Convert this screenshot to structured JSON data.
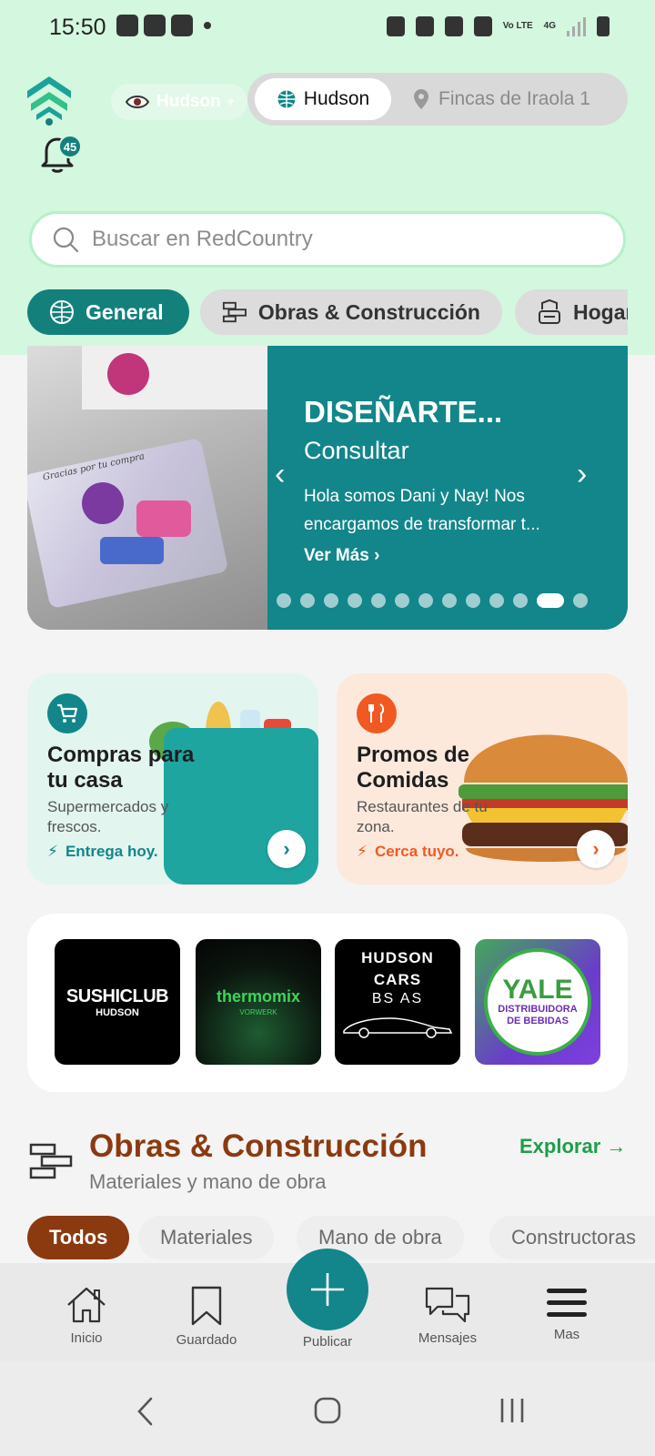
{
  "status_bar": {
    "time": "15:50",
    "network_label": "4G",
    "lte_label": "Vo LTE"
  },
  "header": {
    "notifications_count": "45",
    "community_selector": "Hudson",
    "location_toggle": {
      "active": "Hudson",
      "inactive": "Fincas de Iraola 1"
    }
  },
  "search": {
    "placeholder": "Buscar en RedCountry"
  },
  "categories": [
    {
      "label": "General",
      "active": true
    },
    {
      "label": "Obras & Construcción",
      "active": false
    },
    {
      "label": "Hogar",
      "active": false
    }
  ],
  "hero": {
    "title": "DISEÑARTE...",
    "subtitle": "Consultar",
    "description": "Hola somos Dani y Nay! Nos encargamos de transformar t...",
    "more_label": "Ver Más",
    "slide_count": 13,
    "active_slide": 11,
    "photo_caption": "Gracias por tu compra"
  },
  "promos": [
    {
      "title": "Compras para tu casa",
      "subtitle": "Supermercados y frescos.",
      "tag": "Entrega hoy.",
      "accent": "#12868a"
    },
    {
      "title": "Promos de Comidas",
      "subtitle": "Restaurantes de tu zona.",
      "tag": "Cerca tuyo.",
      "accent": "#f05a22"
    }
  ],
  "brands": [
    {
      "name": "SUSHICLUB",
      "sub": "HUDSON"
    },
    {
      "name": "thermomix",
      "sub": "VORWERK"
    },
    {
      "name": "HUDSON CARS",
      "sub": "BS AS"
    },
    {
      "name": "YALE",
      "sub": "DISTRIBUIDORA DE BEBIDAS"
    }
  ],
  "section": {
    "title": "Obras & Construcción",
    "subtitle": "Materiales y mano de obra",
    "explore_label": "Explorar →"
  },
  "subtabs": [
    {
      "label": "Todos",
      "active": true
    },
    {
      "label": "Materiales",
      "active": false
    },
    {
      "label": "Mano de obra",
      "active": false
    },
    {
      "label": "Constructoras",
      "active": false
    }
  ],
  "bottom_nav": [
    {
      "label": "Inicio",
      "icon": "home-icon"
    },
    {
      "label": "Guardado",
      "icon": "bookmark-icon"
    },
    {
      "label": "Publicar",
      "icon": "plus-icon"
    },
    {
      "label": "Mensajes",
      "icon": "chat-icon"
    },
    {
      "label": "Mas",
      "icon": "menu-icon"
    }
  ],
  "colors": {
    "brand_teal": "#12868a",
    "mint_bg": "#d4f7df",
    "section_brown": "#8b3a10",
    "explore_green": "#1e9e4a",
    "orange": "#f05a22"
  }
}
